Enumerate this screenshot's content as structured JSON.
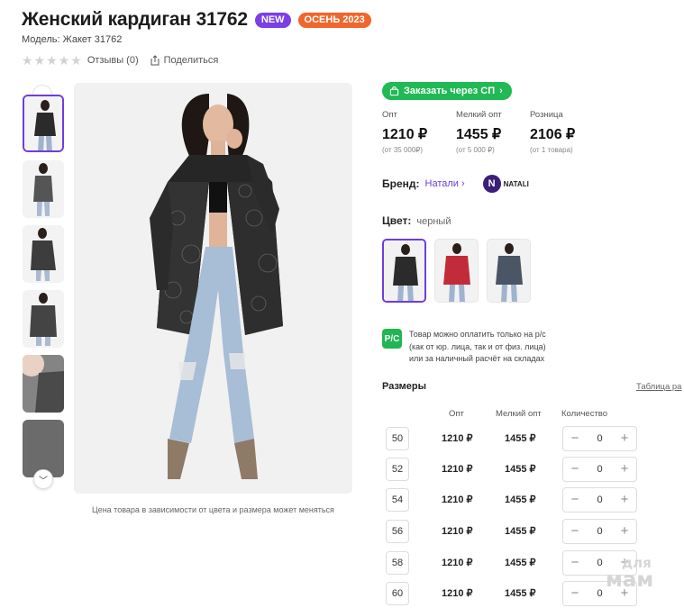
{
  "product": {
    "title": "Женский кардиган 31762",
    "badges": [
      "NEW",
      "ОСЕНЬ 2023"
    ],
    "model": "Модель: Жакет 31762",
    "reviews": "Отзывы (0)",
    "share": "Поделиться",
    "rating_stars": 0
  },
  "gallery": {
    "caption": "Цена товара в зависимости от цвета и размера может меняться"
  },
  "order_button": "Заказать через СП",
  "prices": [
    {
      "label": "Опт",
      "value": "1210 ₽",
      "note": "(от 35 000₽)"
    },
    {
      "label": "Мелкий опт",
      "value": "1455 ₽",
      "note": "(от 5 000 ₽)"
    },
    {
      "label": "Розница",
      "value": "2106 ₽",
      "note": "(от 1 товара)"
    }
  ],
  "brand": {
    "label": "Бренд:",
    "name": "Натали",
    "logo_text": "NATALI"
  },
  "color": {
    "label": "Цвет:",
    "value": "черный"
  },
  "payment_note": {
    "icon_text": "Р/С",
    "lines": [
      "Товар можно оплатить только на р/с",
      "(как от юр. лица, так и от физ. лица)",
      "или за наличный расчёт на складах"
    ]
  },
  "sizes": {
    "title": "Размеры",
    "table_link": "Таблица ра",
    "headers": [
      "Опт",
      "Мелкий опт",
      "Количество"
    ],
    "rows": [
      {
        "size": "50",
        "opt": "1210 ₽",
        "small": "1455 ₽",
        "qty": "0"
      },
      {
        "size": "52",
        "opt": "1210 ₽",
        "small": "1455 ₽",
        "qty": "0"
      },
      {
        "size": "54",
        "opt": "1210 ₽",
        "small": "1455 ₽",
        "qty": "0"
      },
      {
        "size": "56",
        "opt": "1210 ₽",
        "small": "1455 ₽",
        "qty": "0"
      },
      {
        "size": "58",
        "opt": "1210 ₽",
        "small": "1455 ₽",
        "qty": "0"
      },
      {
        "size": "60",
        "opt": "1210 ₽",
        "small": "1455 ₽",
        "qty": "0"
      }
    ]
  },
  "watermark": [
    "для",
    "мам"
  ],
  "colors": {
    "accent": "#6f3ce3",
    "green": "#20b954",
    "badge_new": "#7b3fe4",
    "badge_autumn": "#f0662c"
  }
}
